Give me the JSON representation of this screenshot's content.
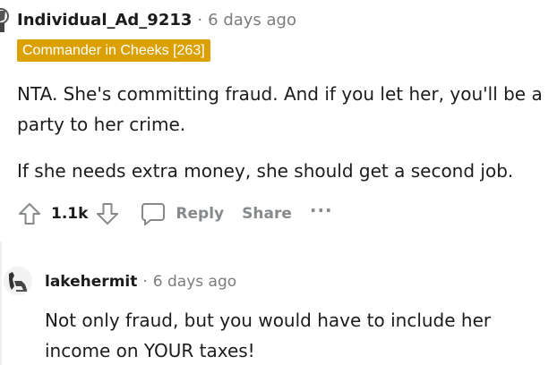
{
  "comment": {
    "username": "Individual_Ad_9213",
    "separator": "·",
    "time": "6 days ago",
    "flair": "Commander in Cheeks [263]",
    "paragraphs": [
      "NTA. She's committing fraud. And if you let her, you'll be a party to her crime.",
      "If she needs extra money, she should get a second job."
    ],
    "score": "1.1k",
    "reply_label": "Reply",
    "share_label": "Share",
    "more_label": "···",
    "flair_color": "#dba102"
  },
  "reply": {
    "username": "lakehermit",
    "separator": "·",
    "time": "6 days ago",
    "text": "Not only fraud, but you would have to include her income on YOUR taxes!"
  },
  "icons": {
    "upvote": "arrow-up-icon",
    "downvote": "arrow-down-icon",
    "comment": "speech-bubble-icon",
    "more": "ellipsis-icon"
  }
}
